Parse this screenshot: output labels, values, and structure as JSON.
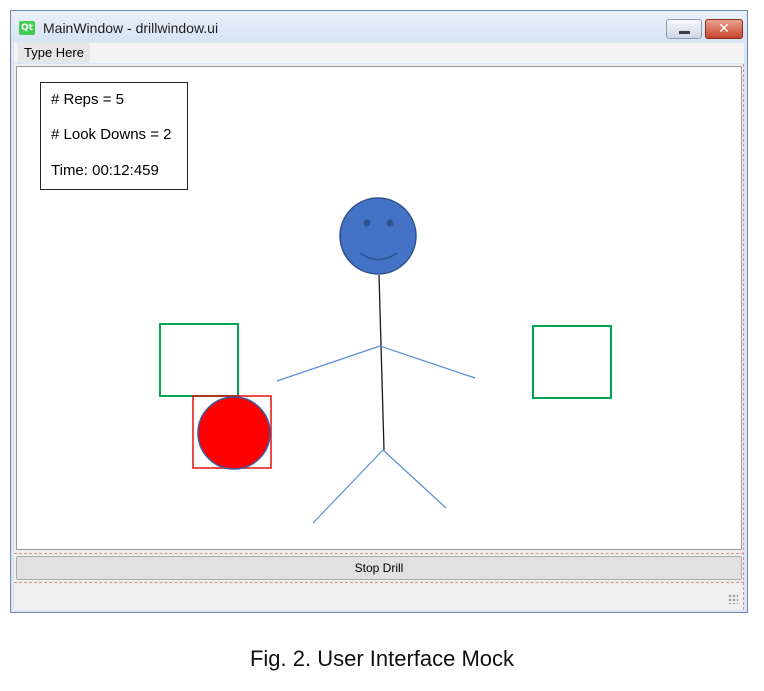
{
  "window": {
    "qt_logo": "Qt",
    "title": "MainWindow - drillwindow.ui",
    "close_symbol": "✕"
  },
  "menubar": {
    "items": [
      {
        "label": "Type Here"
      }
    ]
  },
  "stats": {
    "reps": "# Reps = 5",
    "look_downs": "# Look Downs = 2",
    "time": "Time: 00:12:459"
  },
  "scene": {
    "figure": {
      "head_color": "#4472c4",
      "body_color": "#1a1a1a",
      "limb_color": "#5b8fd6"
    },
    "target_boxes": [
      {
        "side": "left",
        "color": "#00a550"
      },
      {
        "side": "right",
        "color": "#00a550"
      }
    ],
    "ball": {
      "color": "#ff0000",
      "outline": "#3b5aa0",
      "box_color": "#e01010"
    }
  },
  "buttons": {
    "stop": "Stop Drill"
  },
  "caption": "Fig. 2. User Interface Mock"
}
